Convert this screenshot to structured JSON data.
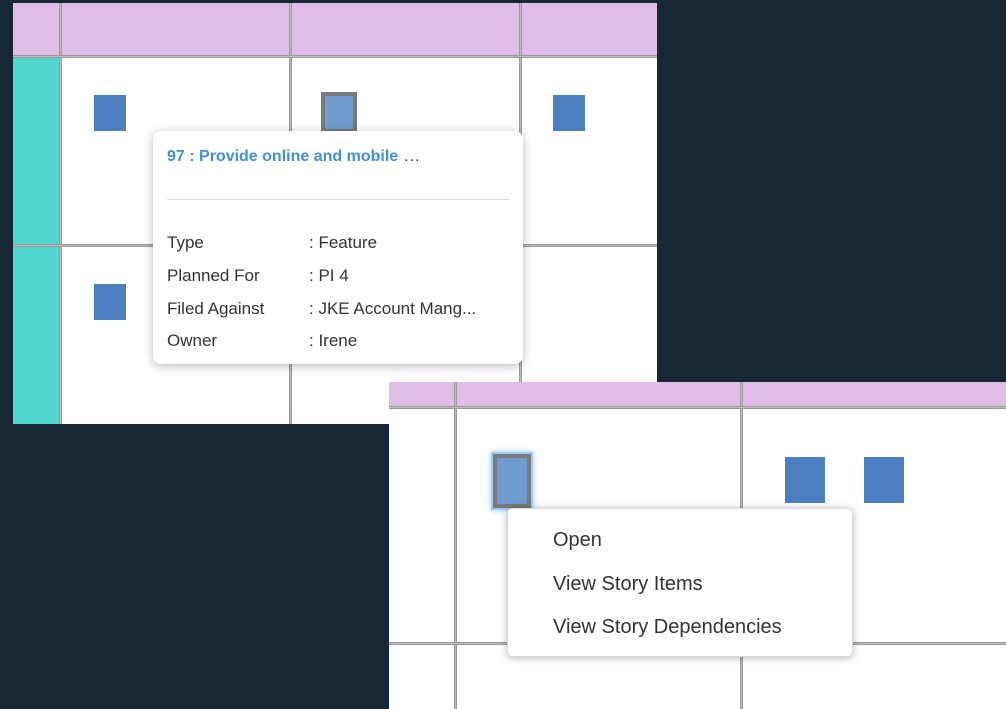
{
  "tooltip": {
    "title": "97 : Provide online and mobile",
    "title_ellipsis": "...",
    "rows": [
      {
        "key": "Type",
        "value": ": Feature"
      },
      {
        "key": "Planned For",
        "value": ": PI 4"
      },
      {
        "key": "Filed Against",
        "value": ": JKE Account Mang..."
      },
      {
        "key": "Owner",
        "value": ": Irene"
      }
    ]
  },
  "context_menu": {
    "items": [
      "Open",
      "View Story Items",
      "View Story Dependencies"
    ]
  },
  "colors": {
    "header": "#dfbde6",
    "team_lane": "#4fd6cf",
    "card": "#4a7fc1",
    "card_selected": "#6f9bcf",
    "tooltip_title": "#3f8fdb",
    "background": "#172735"
  }
}
